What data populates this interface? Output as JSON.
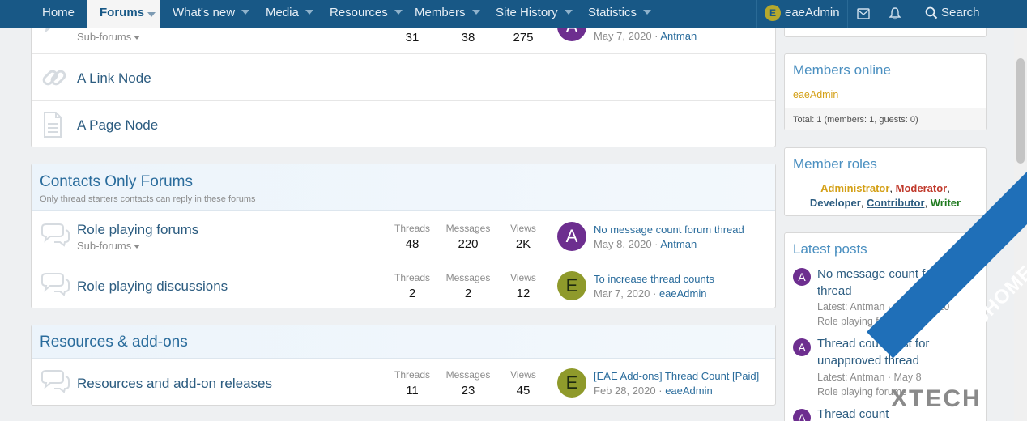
{
  "nav": {
    "items": [
      {
        "label": "Home"
      },
      {
        "label": "Forums"
      },
      {
        "label": "What's new"
      },
      {
        "label": "Media"
      },
      {
        "label": "Resources"
      },
      {
        "label": "Members"
      },
      {
        "label": "Site History"
      },
      {
        "label": "Statistics"
      }
    ],
    "user_initial": "E",
    "username": "eaeAdmin",
    "search_label": "Search"
  },
  "block1": {
    "rows": [
      {
        "sub": "Sub-forums",
        "threads": "31",
        "messages": "38",
        "views": "275",
        "av": "A",
        "date": "May 7, 2020",
        "user": "Antman"
      },
      {
        "title": "A Link Node"
      },
      {
        "title": "A Page Node"
      }
    ]
  },
  "block2": {
    "title": "Contacts Only Forums",
    "desc": "Only thread starters contacts can reply in these forums",
    "rows": [
      {
        "title": "Role playing forums",
        "sub": "Sub-forums",
        "threads": "48",
        "messages": "220",
        "views": "2K",
        "av": "A",
        "last_title": "No message count forum thread",
        "date": "May 8, 2020",
        "user": "Antman"
      },
      {
        "title": "Role playing discussions",
        "threads": "2",
        "messages": "2",
        "views": "12",
        "av": "E",
        "last_title": "To increase thread counts",
        "date": "Mar 7, 2020",
        "user": "eaeAdmin"
      }
    ]
  },
  "block3": {
    "title": "Resources & add-ons",
    "rows": [
      {
        "title": "Resources and add-on releases",
        "threads": "11",
        "messages": "23",
        "views": "45",
        "av": "E",
        "last_title": "[EAE Add-ons] Thread Count [Paid]",
        "date": "Feb 28, 2020",
        "user": "eaeAdmin"
      }
    ]
  },
  "labels": {
    "threads": "Threads",
    "messages": "Messages",
    "views": "Views",
    "sep": " · "
  },
  "members_online": {
    "title": "Members online",
    "user": "eaeAdmin",
    "total": "Total: 1 (members: 1, guests: 0)"
  },
  "member_roles": {
    "title": "Member roles",
    "roles": [
      "Administrator",
      "Moderator",
      "Developer",
      "Contributor",
      "Writer"
    ]
  },
  "latest_posts": {
    "title": "Latest posts",
    "items": [
      {
        "av": "A",
        "title": "No message count forum thread",
        "meta": "Latest: Antman · May 8, 2020",
        "forum": "Role playing forums"
      },
      {
        "av": "A",
        "title": "Thread count test for unapproved thread",
        "meta": "Latest: Antman · May 8",
        "forum": "Role playing forums"
      },
      {
        "av": "A",
        "title": "Thread count"
      }
    ]
  },
  "watermark": {
    "text": "TECHIESHOME.COM",
    "text2": "XTECH"
  },
  "colors": {
    "nav": "#185886",
    "link": "#2c5c80",
    "admin": "#d4a017",
    "moderator": "#c0392b",
    "developer": "#2c5c80",
    "writer": "#1f7a1f"
  }
}
